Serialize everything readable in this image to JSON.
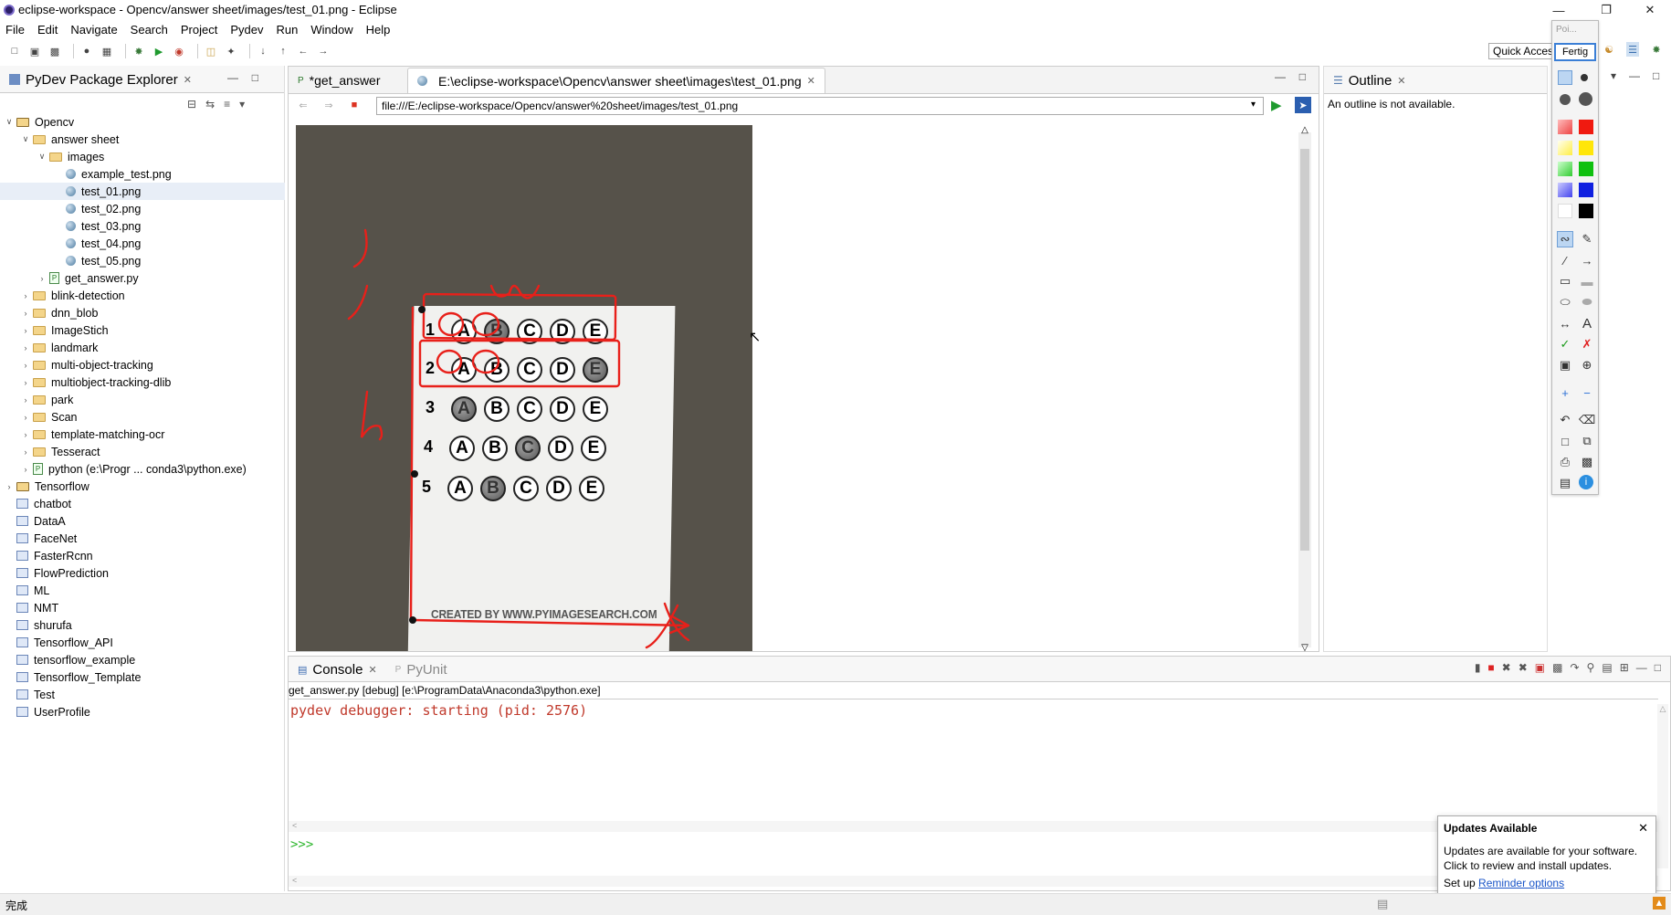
{
  "window": {
    "title": "eclipse-workspace - Opencv/answer sheet/images/test_01.png - Eclipse"
  },
  "menu": [
    "File",
    "Edit",
    "Navigate",
    "Search",
    "Project",
    "Pydev",
    "Run",
    "Window",
    "Help"
  ],
  "quick_access": "Quick Access",
  "explorer": {
    "tab_label": "PyDev Package Explorer",
    "items": [
      {
        "label": "Opencv",
        "type": "project",
        "depth": 0,
        "expanded": true
      },
      {
        "label": "answer sheet",
        "type": "folder",
        "depth": 1,
        "expanded": true
      },
      {
        "label": "images",
        "type": "folder",
        "depth": 2,
        "expanded": true
      },
      {
        "label": "example_test.png",
        "type": "image",
        "depth": 3
      },
      {
        "label": "test_01.png",
        "type": "image",
        "depth": 3,
        "selected": true
      },
      {
        "label": "test_02.png",
        "type": "image",
        "depth": 3
      },
      {
        "label": "test_03.png",
        "type": "image",
        "depth": 3
      },
      {
        "label": "test_04.png",
        "type": "image",
        "depth": 3
      },
      {
        "label": "test_05.png",
        "type": "image",
        "depth": 3
      },
      {
        "label": "get_answer.py",
        "type": "py",
        "depth": 2,
        "collapsed": true
      },
      {
        "label": "blink-detection",
        "type": "folder",
        "depth": 1,
        "collapsed": true
      },
      {
        "label": "dnn_blob",
        "type": "folder",
        "depth": 1,
        "collapsed": true
      },
      {
        "label": "ImageStich",
        "type": "folder",
        "depth": 1,
        "collapsed": true
      },
      {
        "label": "landmark",
        "type": "folder",
        "depth": 1,
        "collapsed": true
      },
      {
        "label": "multi-object-tracking",
        "type": "folder",
        "depth": 1,
        "collapsed": true
      },
      {
        "label": "multiobject-tracking-dlib",
        "type": "folder",
        "depth": 1,
        "collapsed": true
      },
      {
        "label": "park",
        "type": "folder",
        "depth": 1,
        "collapsed": true
      },
      {
        "label": "Scan",
        "type": "folder",
        "depth": 1,
        "collapsed": true
      },
      {
        "label": "template-matching-ocr",
        "type": "folder",
        "depth": 1,
        "collapsed": true
      },
      {
        "label": "Tesseract",
        "type": "folder",
        "depth": 1,
        "collapsed": true
      },
      {
        "label": "python  (e:\\Progr ... conda3\\python.exe)",
        "type": "py",
        "depth": 1,
        "collapsed": true
      },
      {
        "label": "Tensorflow",
        "type": "project",
        "depth": 0,
        "collapsed": true
      },
      {
        "label": "chatbot",
        "type": "proj",
        "depth": 0
      },
      {
        "label": "DataA",
        "type": "proj",
        "depth": 0
      },
      {
        "label": "FaceNet",
        "type": "proj",
        "depth": 0
      },
      {
        "label": "FasterRcnn",
        "type": "proj",
        "depth": 0
      },
      {
        "label": "FlowPrediction",
        "type": "proj",
        "depth": 0
      },
      {
        "label": "ML",
        "type": "proj",
        "depth": 0
      },
      {
        "label": "NMT",
        "type": "proj",
        "depth": 0
      },
      {
        "label": "shurufa",
        "type": "proj",
        "depth": 0
      },
      {
        "label": "Tensorflow_API",
        "type": "proj",
        "depth": 0
      },
      {
        "label": "tensorflow_example",
        "type": "proj",
        "depth": 0
      },
      {
        "label": "Tensorflow_Template",
        "type": "proj",
        "depth": 0
      },
      {
        "label": "Test",
        "type": "proj",
        "depth": 0
      },
      {
        "label": "UserProfile",
        "type": "proj",
        "depth": 0
      }
    ]
  },
  "editor": {
    "tabs": [
      {
        "label": "*get_answer",
        "active": false
      },
      {
        "label": "E:\\eclipse-workspace\\Opencv\\answer sheet\\images\\test_01.png",
        "active": true
      }
    ],
    "url": "file:///E:/eclipse-workspace/Opencv/answer%20sheet/images/test_01.png"
  },
  "sheet": {
    "rows": [
      {
        "num": "1",
        "choices": [
          "A",
          "B",
          "C",
          "D",
          "E"
        ],
        "filled": 1
      },
      {
        "num": "2",
        "choices": [
          "A",
          "B",
          "C",
          "D",
          "E"
        ],
        "filled": 4
      },
      {
        "num": "3",
        "choices": [
          "A",
          "B",
          "C",
          "D",
          "E"
        ],
        "filled": 0
      },
      {
        "num": "4",
        "choices": [
          "A",
          "B",
          "C",
          "D",
          "E"
        ],
        "filled": 2
      },
      {
        "num": "5",
        "choices": [
          "A",
          "B",
          "C",
          "D",
          "E"
        ],
        "filled": 1
      }
    ],
    "credit": "CREATED BY WWW.PYIMAGESEARCH.COM"
  },
  "outline": {
    "tab_label": "Outline",
    "message": "An outline is not available."
  },
  "console": {
    "tabs": [
      "Console",
      "PyUnit"
    ],
    "process": "get_answer.py [debug] [e:\\ProgramData\\Anaconda3\\python.exe]",
    "output": "pydev debugger: starting (pid: 2576)",
    "prompt": ">>>"
  },
  "palette": {
    "header": "Poi...",
    "done_label": "Fertig"
  },
  "popup": {
    "title": "Updates Available",
    "body": "Updates are available for your software. Click to review and install updates.",
    "setup_prefix": "Set up",
    "link": "Reminder options"
  },
  "status": {
    "text": "完成"
  },
  "colors": {
    "annotation": "#e8201a",
    "console_output": "#c0392b",
    "prompt": "#2bb52b",
    "link": "#1a55c8"
  }
}
